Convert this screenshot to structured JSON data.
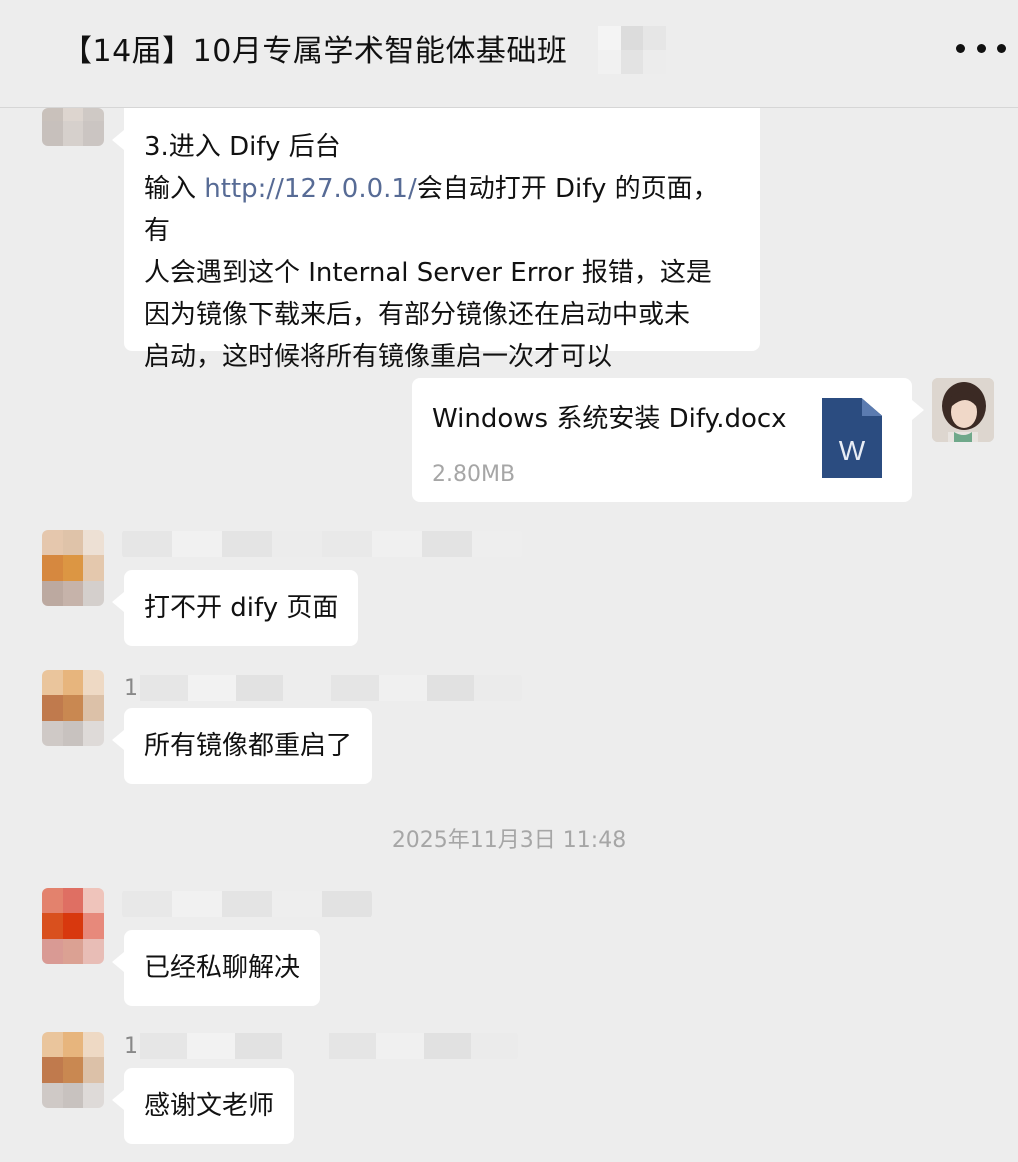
{
  "header": {
    "title": "【14届】10月专属学术智能体基础班"
  },
  "messages": {
    "m1": {
      "line1": "3.进入 Dify 后台",
      "line2_prefix": "输入 ",
      "line2_link": "http://127.0.0.1/",
      "line2_suffix": "会自动打开 Dify 的页面，有",
      "line3": "人会遇到这个 Internal Server Error 报错，这是",
      "line4": "因为镜像下载来后，有部分镜像还在启动中或未",
      "line5": "启动，这时候将所有镜像重启一次才可以"
    },
    "file": {
      "name": "Windows 系统安装 Dify.docx",
      "size": "2.80MB",
      "icon": "word-doc-icon",
      "icon_letter": "W"
    },
    "m2": {
      "text": "打不开 dify 页面"
    },
    "m3": {
      "sender_prefix": "1",
      "text": "所有镜像都重启了"
    },
    "timestamp": "2025年11月3日 11:48",
    "m4": {
      "text": "已经私聊解决"
    },
    "m5": {
      "sender_prefix": "1",
      "text": "感谢文老师"
    }
  },
  "colors": {
    "background": "#ededed",
    "bubble": "#ffffff",
    "link": "#576b95",
    "word_icon": "#2b4c80",
    "meta_text": "#a6a6a6"
  }
}
